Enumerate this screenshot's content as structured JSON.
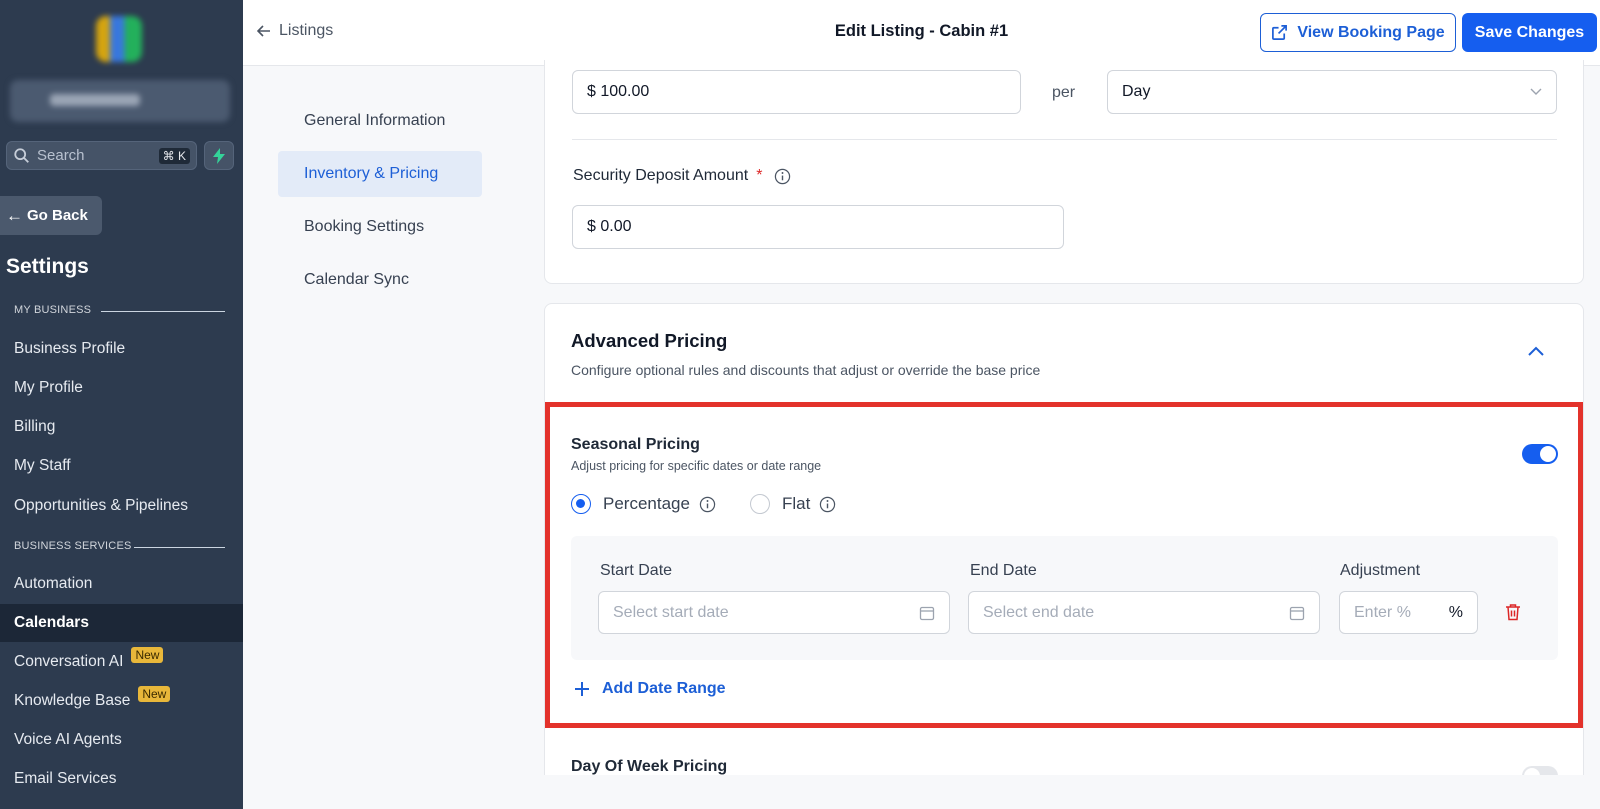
{
  "sidebar": {
    "search_placeholder": "Search",
    "search_shortcut": "⌘ K",
    "go_back": "Go Back",
    "settings_title": "Settings",
    "section_my_business": "MY BUSINESS",
    "section_business_services": "BUSINESS SERVICES",
    "items": [
      {
        "label": "Business Profile"
      },
      {
        "label": "My Profile"
      },
      {
        "label": "Billing"
      },
      {
        "label": "My Staff"
      },
      {
        "label": "Opportunities & Pipelines"
      },
      {
        "label": "Automation"
      },
      {
        "label": "Calendars"
      },
      {
        "label": "Conversation AI",
        "badge": "New"
      },
      {
        "label": "Knowledge Base",
        "badge": "New"
      },
      {
        "label": "Voice AI Agents"
      },
      {
        "label": "Email Services"
      }
    ],
    "active_item": "Calendars",
    "accent_color": "#2d3b4f"
  },
  "header": {
    "breadcrumb": "Listings",
    "title": "Edit Listing - Cabin #1",
    "view_booking_label": "View Booking Page",
    "save_label": "Save Changes"
  },
  "subnav": {
    "items": [
      {
        "label": "General Information"
      },
      {
        "label": "Inventory & Pricing"
      },
      {
        "label": "Booking Settings"
      },
      {
        "label": "Calendar Sync"
      }
    ],
    "active_item": "Inventory & Pricing"
  },
  "pricing": {
    "base_price": "$ 100.00",
    "per_label": "per",
    "per_unit": "Day",
    "security_deposit_label": "Security Deposit Amount",
    "required_mark": "*",
    "security_deposit_value": "$ 0.00"
  },
  "advanced": {
    "title": "Advanced Pricing",
    "description": "Configure optional rules and discounts that adjust or override the base price",
    "seasonal": {
      "title": "Seasonal Pricing",
      "description": "Adjust pricing for specific dates or date range",
      "enabled": true,
      "option_percentage": "Percentage",
      "option_flat": "Flat",
      "selected_option": "Percentage",
      "start_date_label": "Start Date",
      "end_date_label": "End Date",
      "adjustment_label": "Adjustment",
      "start_placeholder": "Select start date",
      "end_placeholder": "Select end date",
      "adjustment_placeholder": "Enter %",
      "adjustment_unit": "%",
      "add_range_label": "Add Date Range"
    },
    "day_of_week": {
      "title": "Day Of Week Pricing",
      "enabled": false
    }
  },
  "colors": {
    "primary": "#155eef",
    "highlight_border": "#e3322b",
    "delete_red": "#dc2626",
    "badge_new": "#e8b73a"
  }
}
